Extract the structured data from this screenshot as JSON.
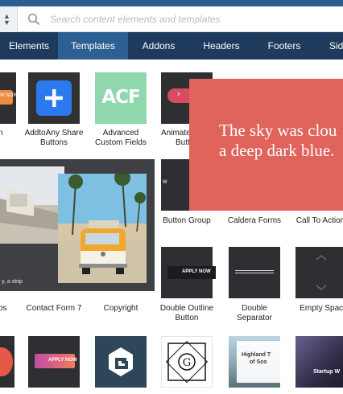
{
  "search": {
    "placeholder": "Search content elements and templates"
  },
  "tabs": [
    {
      "label": "Elements"
    },
    {
      "label": "Templates"
    },
    {
      "label": "Addons"
    },
    {
      "label": "Headers"
    },
    {
      "label": "Footers"
    },
    {
      "label": "Side"
    }
  ],
  "row1": {
    "first_cap": "n",
    "addtoany": {
      "line1": "AddtoAny Share",
      "line2": "Buttons"
    },
    "acf": {
      "logo_text": "ACF",
      "line1": "Advanced",
      "line2": "Custom Fields"
    },
    "animated": {
      "line1": "Animate",
      "line2": "Butt"
    }
  },
  "row2": {
    "button_group": "Button Group",
    "caldera": "Caldera Forms",
    "cta": "Call To Action",
    "button_group_tile_text": "W"
  },
  "row3": {
    "first_cap": "bs",
    "contact_form": "Contact Form 7",
    "copyright": "Copyright",
    "double_outline": {
      "line1": "Double Outline",
      "line2": "Button",
      "tile_text": "APPLY NOW"
    },
    "double_separator": {
      "line1": "Double",
      "line2": "Separator"
    },
    "empty_space": "Empty Space"
  },
  "row4": {
    "apply_text": "APPLY NOW",
    "highland_line1": "Highland T",
    "highland_line2": "of Sco",
    "startup_text": "Startup W"
  },
  "row1_first_tile_text": "W NOW",
  "note": {
    "line1": "The sky was clou",
    "line2": "a deep dark blue."
  },
  "photo_caption": "y, a strip"
}
